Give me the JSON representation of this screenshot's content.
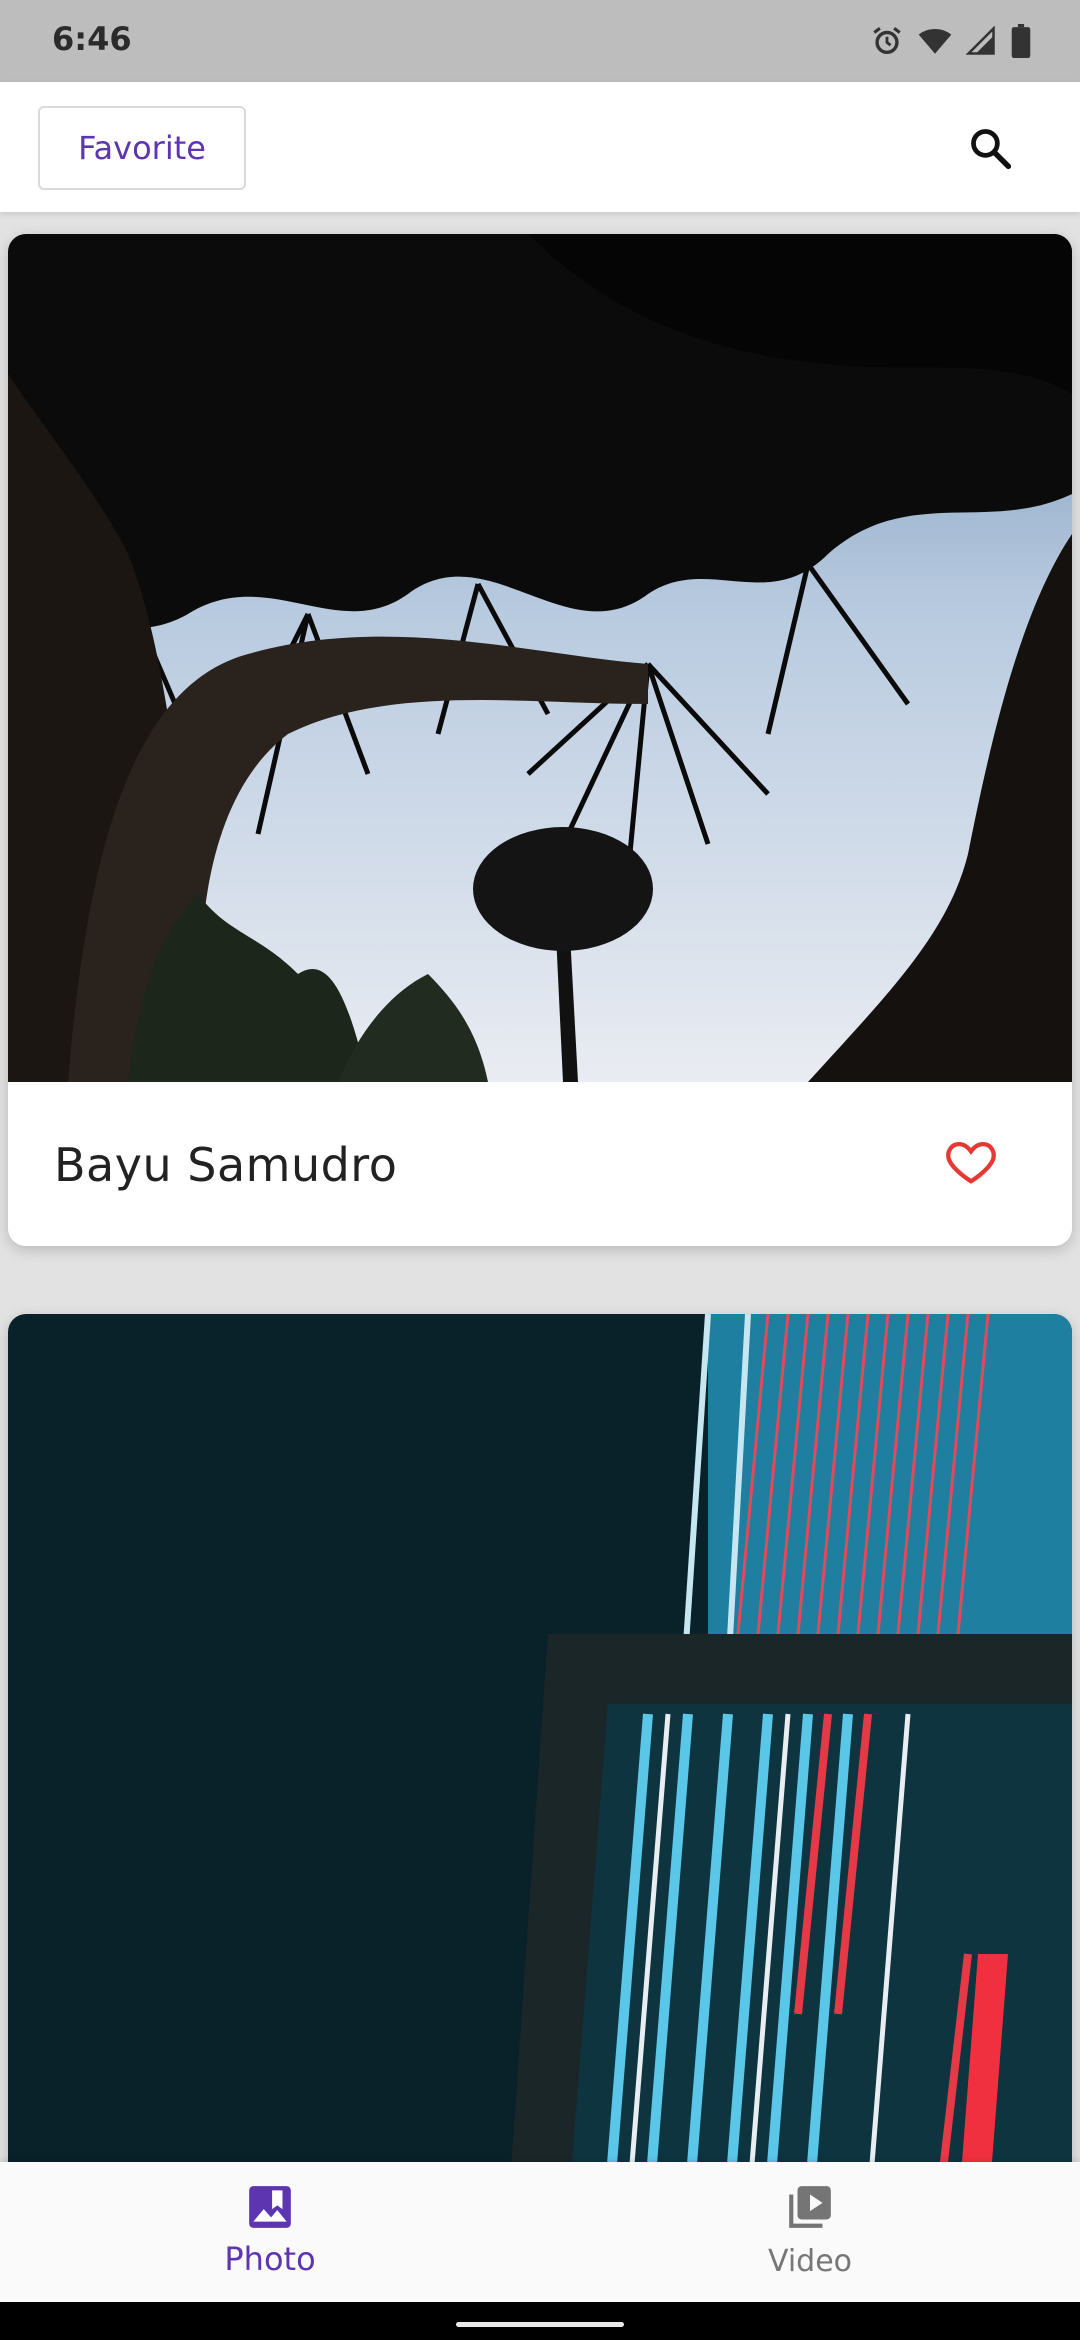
{
  "status_bar": {
    "time": "6:46",
    "icons": [
      "alarm-icon",
      "wifi-icon",
      "signal-icon",
      "battery-icon"
    ]
  },
  "app_bar": {
    "favorite_label": "Favorite",
    "search_icon": "search-icon",
    "accent_color": "#5e35b1"
  },
  "feed": {
    "cards": [
      {
        "photographer": "Bayu Samudro",
        "favorite_icon": "heart-outline-icon",
        "heart_color": "#e53935"
      },
      {
        "photographer": "",
        "favorite_icon": ""
      }
    ]
  },
  "bottom_nav": {
    "items": [
      {
        "label": "Photo",
        "icon": "photo-icon",
        "selected": true
      },
      {
        "label": "Video",
        "icon": "video-library-icon",
        "selected": false
      }
    ]
  }
}
